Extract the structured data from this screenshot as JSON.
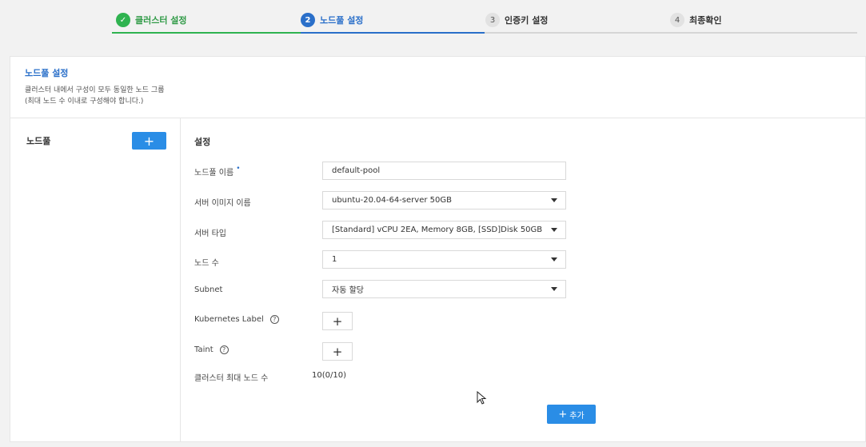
{
  "stepper": {
    "steps": [
      {
        "num": "✓",
        "label": "클러스터 설정",
        "state": "done"
      },
      {
        "num": "2",
        "label": "노드풀 설정",
        "state": "active"
      },
      {
        "num": "3",
        "label": "인증키 설정",
        "state": "todo"
      },
      {
        "num": "4",
        "label": "최종확인",
        "state": "todo"
      }
    ]
  },
  "panel": {
    "title": "노드풀 설정",
    "desc_line1": "클러스터 내에서 구성이 모두 동일한 노드 그룹",
    "desc_line2": "(최대 노드 수 이내로 구성해야 합니다.)"
  },
  "left": {
    "label": "노드풀",
    "add_icon": "+"
  },
  "settings": {
    "title": "설정",
    "nodepool_name": {
      "label": "노드풀 이름",
      "required_mark": "•",
      "value": "default-pool"
    },
    "server_image": {
      "label": "서버 이미지 이름",
      "value": "ubuntu-20.04-64-server 50GB"
    },
    "server_type": {
      "label": "서버 타입",
      "value": "[Standard] vCPU 2EA, Memory 8GB, [SSD]Disk 50GB"
    },
    "node_count": {
      "label": "노드 수",
      "value": "1"
    },
    "subnet": {
      "label": "Subnet",
      "value": "자동 할당"
    },
    "k8s_label": {
      "label": "Kubernetes Label",
      "help": "?",
      "add": "+"
    },
    "taint": {
      "label": "Taint",
      "help": "?",
      "add": "+"
    },
    "max_nodes": {
      "label": "클러스터 최대 노드 수",
      "value": "10(0/10)"
    },
    "add_button": {
      "icon": "+",
      "label": "추가"
    }
  },
  "colors": {
    "accent": "#2a6fc9",
    "button": "#2a8de6",
    "done": "#2fb350"
  }
}
